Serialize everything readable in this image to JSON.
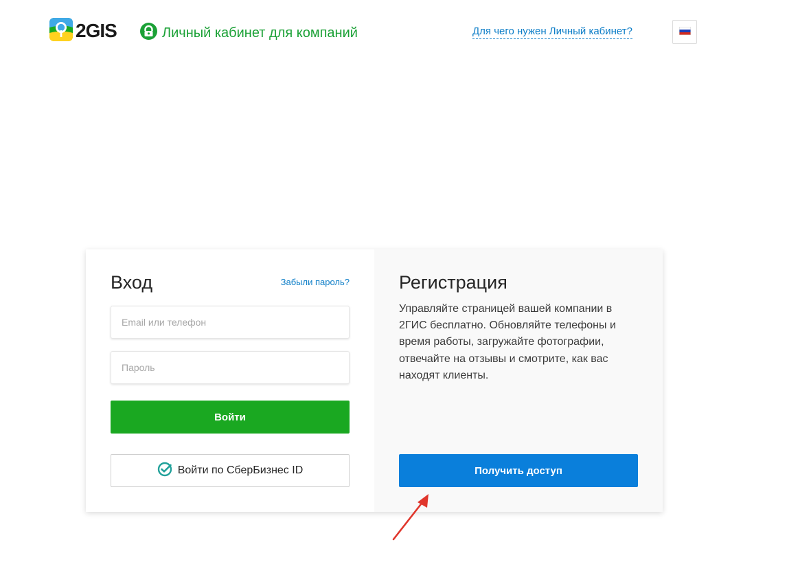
{
  "header": {
    "logo_text": "2GIS",
    "cabinet_title": "Личный кабинет для компаний",
    "help_link": "Для чего нужен Личный кабинет?",
    "language_flag": "russia-flag-icon"
  },
  "login": {
    "title": "Вход",
    "forgot_password": "Забыли пароль?",
    "email_placeholder": "Email или телефон",
    "email_value": "",
    "password_placeholder": "Пароль",
    "password_value": "",
    "submit_label": "Войти",
    "sber_label": "Войти по СберБизнес ID"
  },
  "registration": {
    "title": "Регистрация",
    "description": "Управляйте страницей вашей компании в 2ГИС бесплатно. Обновляйте телефоны и время работы, загружайте фотографии, отвечайте на отзывы и смотрите, как вас находят клиенты.",
    "access_label": "Получить доступ"
  },
  "colors": {
    "brand_green": "#1aa821",
    "accent_blue": "#0a7fdb",
    "link_blue": "#0c7dc7",
    "annotation_red": "#e0362c"
  },
  "icons": [
    "2gis-logo-icon",
    "account-lock-icon",
    "russia-flag-icon",
    "sber-check-icon",
    "red-arrow-annotation"
  ]
}
